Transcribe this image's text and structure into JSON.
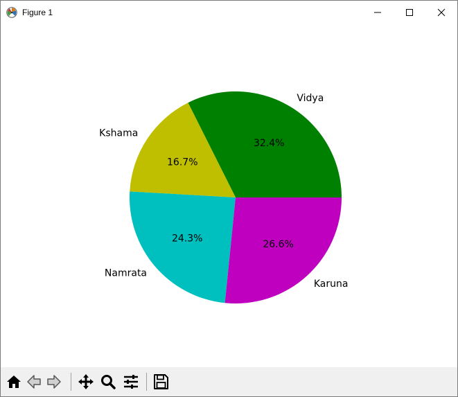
{
  "window": {
    "title": "Figure 1"
  },
  "titlebar_buttons": {
    "minimize_icon": "minimize-icon",
    "maximize_icon": "maximize-icon",
    "close_icon": "close-icon"
  },
  "toolbar": {
    "buttons": [
      {
        "name": "home-button",
        "icon": "home-icon"
      },
      {
        "name": "back-button",
        "icon": "back-arrow-icon"
      },
      {
        "name": "forward-button",
        "icon": "forward-arrow-icon"
      },
      {
        "name": "pan-button",
        "icon": "move-icon"
      },
      {
        "name": "zoom-button",
        "icon": "magnifier-icon"
      },
      {
        "name": "configure-subplots-button",
        "icon": "sliders-icon"
      },
      {
        "name": "save-button",
        "icon": "floppy-disk-icon"
      }
    ]
  },
  "chart_data": {
    "type": "pie",
    "title": "",
    "categories": [
      "Vidya",
      "Kshama",
      "Namrata",
      "Karuna"
    ],
    "values": [
      32.4,
      16.7,
      24.3,
      26.6
    ],
    "labels": [
      "32.4%",
      "16.7%",
      "24.3%",
      "26.6%"
    ],
    "colors": [
      "#008000",
      "#bfbf00",
      "#00bfbf",
      "#bf00bf"
    ],
    "start_angle_deg": 0,
    "direction": "counterclockwise",
    "legend": "none"
  }
}
